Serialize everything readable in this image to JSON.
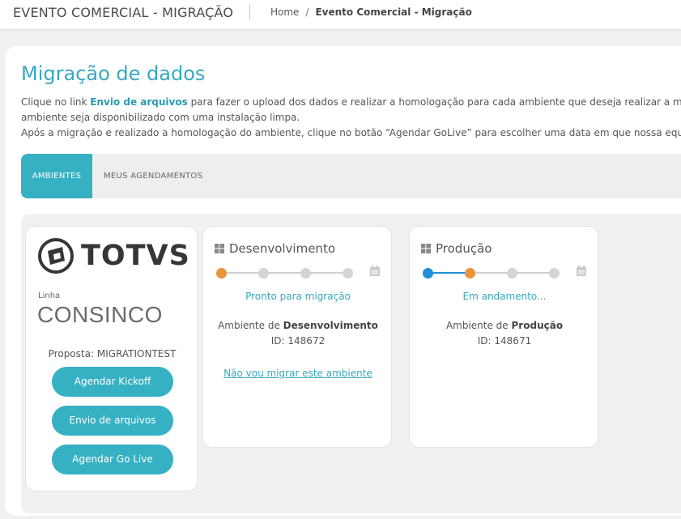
{
  "header": {
    "app_title": "EVENTO COMERCIAL - MIGRAÇÃO",
    "breadcrumb": {
      "home": "Home",
      "separator": "/",
      "current": "Evento Comercial - Migração"
    }
  },
  "page": {
    "title": "Migração de dados",
    "desc_line1_pre": "Clique no link ",
    "desc_line1_link": "Envio de arquivos",
    "desc_line1_post": " para fazer o upload dos dados e realizar a homologação para cada ambiente que deseja realizar a migr",
    "desc_line2": "ambiente seja disponibilizado com uma instalação limpa.",
    "desc_line3": "Após a migração e realizado a homologação do ambiente, clique no botão “Agendar GoLive” para escolher uma data em que nossa equip"
  },
  "tabs": [
    {
      "label": "AMBIENTES",
      "active": true
    },
    {
      "label": "MEUS AGENDAMENTOS",
      "active": false
    }
  ],
  "brand": {
    "logo_text": "TOTVS",
    "linha_label": "Linha",
    "product": "CONSINCO",
    "proposta_label": "Proposta:",
    "proposta_value": "MIGRATIONTEST",
    "buttons": [
      "Agendar Kickoff",
      "Envio de arquivos",
      "Agendar Go Live"
    ]
  },
  "environments": [
    {
      "name": "Desenvolvimento",
      "status": "Pronto para migração",
      "ambiente_prefix": "Ambiente de",
      "ambiente_name": "Desenvolvimento",
      "id_label": "ID: 148672",
      "link": "Não vou migrar este ambiente",
      "steps": [
        "done",
        "pending",
        "pending",
        "pending"
      ]
    },
    {
      "name": "Produção",
      "status": "Em andamento...",
      "ambiente_prefix": "Ambiente de",
      "ambiente_name": "Produção",
      "id_label": "ID: 148671",
      "steps": [
        "active",
        "done",
        "pending",
        "pending"
      ]
    }
  ],
  "colors": {
    "accent": "#36b1c4",
    "step_done": "#e8943a",
    "step_active": "#1f8fd6",
    "step_pending": "#d4d4d4"
  },
  "icons": {
    "env": "windows-icon",
    "schedule": "calendar-icon"
  }
}
